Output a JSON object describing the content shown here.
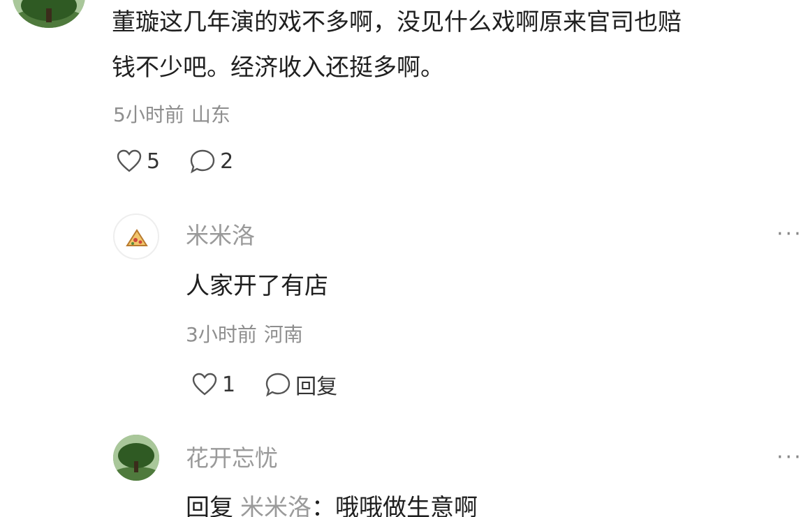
{
  "top_comment": {
    "text_line1": "董璇这几年演的戏不多啊，没见什么戏啊原来官司也赔",
    "text_line2": "钱不少吧。经济收入还挺多啊。",
    "time": "5小时前",
    "location": "山东",
    "likes": "5",
    "comments": "2",
    "avatar_icon": "tree-avatar"
  },
  "replies": [
    {
      "name": "米米洛",
      "text": "人家开了有店",
      "time": "3小时前",
      "location": "河南",
      "likes": "1",
      "reply_label": "回复",
      "avatar_icon": "pizza-avatar",
      "more_label": "···"
    },
    {
      "name": "花开忘忧",
      "reply_prefix": "回复",
      "reply_target": "米米洛",
      "reply_colon": "：",
      "text": "哦哦做生意啊",
      "avatar_icon": "tree-avatar",
      "more_label": "···"
    }
  ],
  "colors": {
    "primary_text": "#1f1f1f",
    "secondary_text": "#8e8e8e",
    "name_text": "#9a9a9a",
    "background": "#ffffff"
  }
}
